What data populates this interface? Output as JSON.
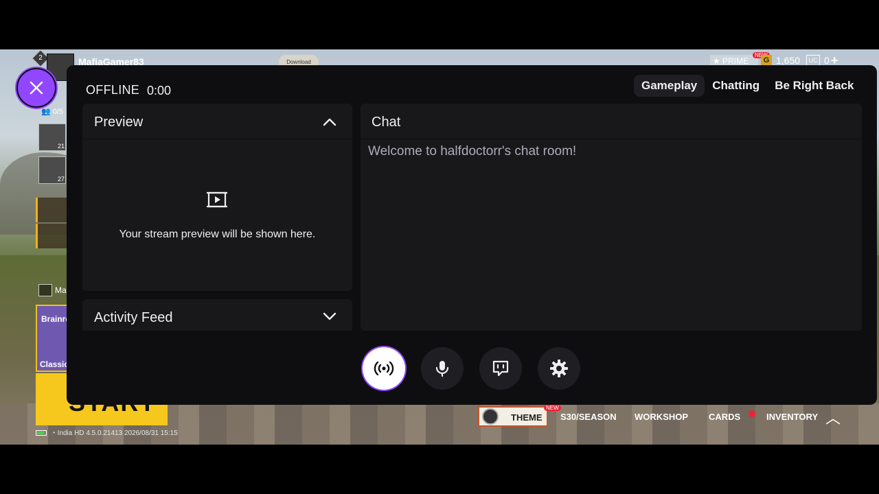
{
  "game": {
    "rank_badge": "2",
    "player_name": "MafiaGamer83",
    "download_label": "Download",
    "prime_label": "PRIME",
    "prime_new": "NEW",
    "currency_g": "G",
    "currency_amount": "1,650",
    "uc_label": "UC",
    "uc_amount": "0",
    "team_count": "0/5",
    "slot_levels": [
      "21",
      "27"
    ],
    "match_label": "Mat",
    "mode_name": "Brainrc",
    "mode_sub": "Classic",
    "start_label": "START",
    "status_region": "India",
    "status_quality": "HD",
    "status_version": "4.5.0.21413 2026/08/31 15:15",
    "bottom_tabs": {
      "theme": "THEME",
      "theme_new": "NEW",
      "season": "S30/SEASON",
      "workshop": "WORKSHOP",
      "cards": "CARDS",
      "inventory": "INVENTORY"
    }
  },
  "stream": {
    "status": "OFFLINE",
    "timer": "0:00",
    "scene_tabs": [
      {
        "label": "Gameplay",
        "active": true
      },
      {
        "label": "Chatting",
        "active": false
      },
      {
        "label": "Be Right Back",
        "active": false
      }
    ],
    "preview": {
      "title": "Preview",
      "placeholder": "Your stream preview will be shown here."
    },
    "activity_feed": {
      "title": "Activity Feed"
    },
    "chat": {
      "title": "Chat",
      "welcome": "Welcome to halfdoctorr's chat room!"
    },
    "controls": [
      {
        "icon": "broadcast-icon"
      },
      {
        "icon": "microphone-icon"
      },
      {
        "icon": "chat-bubble-icon"
      },
      {
        "icon": "gear-icon"
      }
    ]
  },
  "colors": {
    "accent": "#9147ff",
    "panel_bg": "#0e0e10",
    "card_bg": "#18181b",
    "button_bg": "#1f1f23",
    "text": "#efeff1",
    "muted_text": "#adadb8"
  }
}
